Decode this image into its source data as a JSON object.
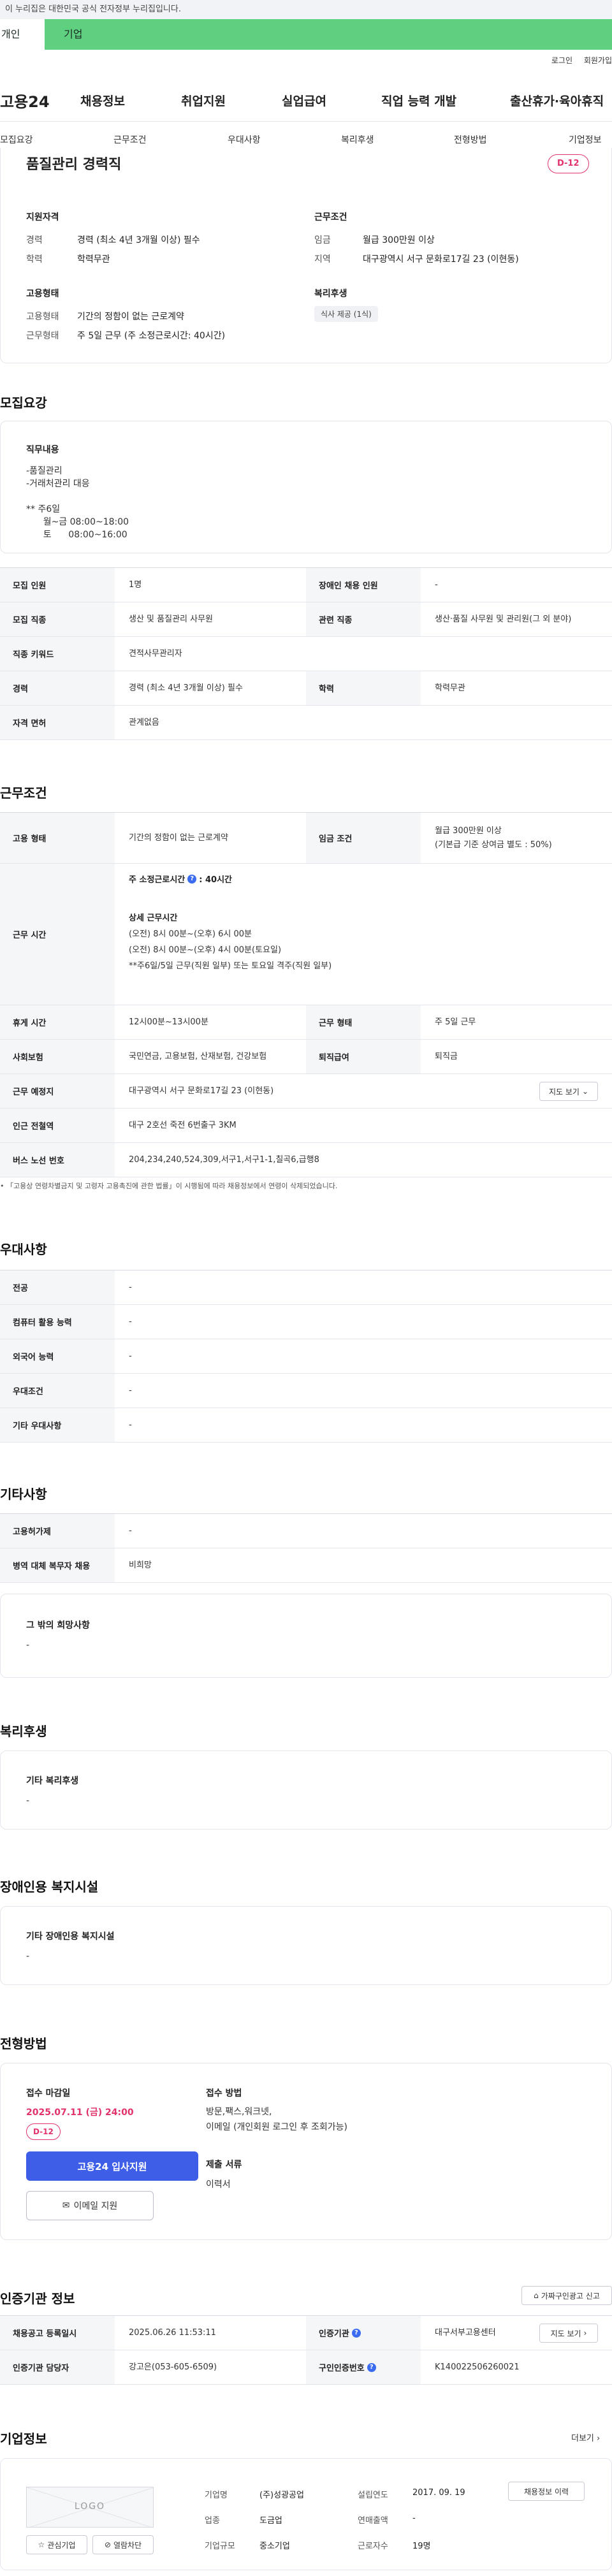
{
  "gov_notice": "이 누리집은 대한민국 공식 전자정부 누리집입니다.",
  "user_tabs": {
    "personal": "개인",
    "company": "기업"
  },
  "util_links": {
    "login": "로그인",
    "signup": "회원가입"
  },
  "gnb": {
    "logo": "고용24",
    "items": [
      "채용정보",
      "취업지원",
      "실업급여",
      "직업 능력 개발",
      "출산휴가·육아휴직"
    ]
  },
  "subnav": [
    "모집요강",
    "근무조건",
    "우대사항",
    "복리후생",
    "전형방법",
    "기업정보"
  ],
  "summary": {
    "title": "품질관리 경력직",
    "dday": "D-12",
    "qualification": {
      "heading": "지원자격",
      "career_label": "경력",
      "career": "경력 (최소 4년 3개월 이상) 필수",
      "education_label": "학력",
      "education": "학력무관"
    },
    "work": {
      "heading": "근무조건",
      "wage_label": "임금",
      "wage": "월급 300만원 이상",
      "region_label": "지역",
      "region": "대구광역시 서구 문화로17길 23 (이현동)"
    },
    "employment": {
      "heading": "고용형태",
      "type_label": "고용형태",
      "type": "기간의 정함이 없는 근로계약",
      "hours_label": "근무형태",
      "hours": "주 5일 근무 (주 소정근로시간: 40시간)"
    },
    "welfare": {
      "heading": "복리후생",
      "chip": "식사 제공 (1식)"
    }
  },
  "recruit": {
    "title": "모집요강",
    "duty_heading": "직무내용",
    "duty_text": "-품질관리\n-거래처관리 대응\n\n** 주6일\n      월~금 08:00~18:00\n      토      08:00~16:00",
    "rows": [
      [
        "모집 인원",
        "1명",
        "장애인 채용 인원",
        "-"
      ],
      [
        "모집 직종",
        "생산 및 품질관리 사무원",
        "관련 직종",
        "생산·품질 사무원 및 관리원(그 외 분야)"
      ],
      [
        "직종 키워드",
        "견적사무관리자",
        "",
        ""
      ],
      [
        "경력",
        "경력 (최소 4년 3개월 이상) 필수",
        "학력",
        "학력무관"
      ],
      [
        "자격 면허",
        "관계없음",
        "",
        ""
      ]
    ]
  },
  "work": {
    "title": "근무조건",
    "employment_label": "고용 형태",
    "employment": "기간의 정함이 없는 근로계약",
    "wage_label": "임금 조건",
    "wage": "월급 300만원 이상\n(기본급 기준 상여금 별도 : 50%)",
    "hours_label": "근무 시간",
    "weekly_hours_label": "주 소정근로시간",
    "weekly_hours": ": 40시간",
    "detail_heading": "상세 근무시간",
    "detail_text": "(오전) 8시 00분~(오후) 6시 00분\n(오전) 8시 00분~(오후) 4시 00분(토요일)\n**주6일/5일 근무(직원 일부) 또는 토요일 격주(직원 일부)",
    "rows": [
      [
        "휴게 시간",
        "12시00분~13시00분",
        "근무 형태",
        "주 5일 근무"
      ],
      [
        "사회보험",
        "국민연금, 고용보험, 산재보험, 건강보험",
        "퇴직급여",
        "퇴직금"
      ],
      [
        "근무 예정지",
        "대구광역시 서구 문화로17길 23 (이현동)",
        "",
        ""
      ],
      [
        "인근 전철역",
        "대구 2호선 죽전 6번출구 3KM",
        "",
        ""
      ],
      [
        "버스 노선 번호",
        "204,234,240,524,309,서구1,서구1-1,칠곡6,급행8",
        "",
        ""
      ]
    ],
    "map_button": "지도 보기",
    "note": "「고용상 연령차별금지 및 고령자 고용촉진에 관한 법률」이 시행됨에 따라 채용정보에서 연령이 삭제되었습니다."
  },
  "preference": {
    "title": "우대사항",
    "rows": [
      [
        "전공",
        "-"
      ],
      [
        "컴퓨터 활용 능력",
        "-"
      ],
      [
        "외국어 능력",
        "-"
      ],
      [
        "우대조건",
        "-"
      ],
      [
        "기타 우대사항",
        "-"
      ]
    ]
  },
  "etc": {
    "title": "기타사항",
    "rows": [
      [
        "고용허가제",
        "-"
      ],
      [
        "병역 대체 복무자 채용",
        "비희망"
      ]
    ],
    "extra_heading": "그 밖의 희망사항",
    "extra_value": "-"
  },
  "welfare": {
    "title": "복리후생",
    "heading": "기타 복리후생",
    "value": "-"
  },
  "disability": {
    "title": "장애인용 복지시설",
    "heading": "기타 장애인용 복지시설",
    "value": "-"
  },
  "selection": {
    "title": "전형방법",
    "deadline_heading": "접수 마감일",
    "deadline": "2025.07.11 (금) 24:00",
    "dday": "D-12",
    "apply_button": "고용24 입사지원",
    "email_button": "이메일 지원",
    "method_heading": "접수 방법",
    "method_text": "방문,팩스,워크넷,\n이메일 (개인회원 로그인 후 조회가능)",
    "docs_heading": "제출 서류",
    "docs": "이력서"
  },
  "cert": {
    "title": "인증기관 정보",
    "report_button": "가짜구인광고 신고",
    "rows": [
      [
        "채용공고 등록일시",
        "2025.06.26 11:53:11",
        "인증기관",
        "대구서부고용센터"
      ],
      [
        "인증기관 담당자",
        "강고은(053-605-6509)",
        "구인인증번호",
        "K140022506260021"
      ]
    ],
    "map_button": "지도 보기"
  },
  "company": {
    "title": "기업정보",
    "more": "더보기",
    "logo_text": "LOGO",
    "interest_button": "관심기업",
    "block_button": "열람차단",
    "labels": {
      "name": "기업명",
      "industry": "업종",
      "size": "기업규모",
      "founded": "설립연도",
      "sales": "연매출액",
      "employees": "근로자수"
    },
    "values": {
      "name": "(주)성광공업",
      "industry": "도금업",
      "size": "중소기업",
      "founded": "2017. 09. 19",
      "sales": "-",
      "employees": "19명"
    },
    "history_button": "채용정보 이력"
  },
  "colors": {
    "tab_green": "#5fcf80",
    "accent_pink": "#e2326a",
    "apply_blue": "#3f5ee8"
  }
}
